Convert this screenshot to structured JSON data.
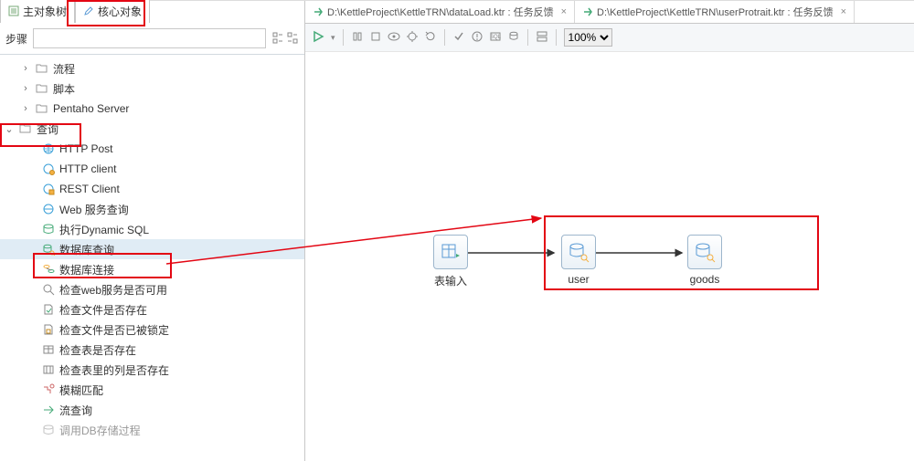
{
  "tabs": {
    "main_object_tree": "主对象树",
    "core_object": "核心对象"
  },
  "filter": {
    "label": "步骤",
    "placeholder": ""
  },
  "tree": {
    "folders": [
      {
        "label": "流程"
      },
      {
        "label": "脚本"
      },
      {
        "label": "Pentaho Server"
      },
      {
        "label": "查询",
        "expanded": true
      }
    ],
    "query_children": [
      "HTTP Post",
      "HTTP client",
      "REST Client",
      "Web 服务查询",
      "执行Dynamic SQL",
      "数据库查询",
      "数据库连接",
      "检查web服务是否可用",
      "检查文件是否存在",
      "检查文件是否已被锁定",
      "检查表是否存在",
      "检查表里的列是否存在",
      "模糊匹配",
      "流查询",
      "调用DB存储过程"
    ]
  },
  "editor": {
    "tabs": [
      {
        "path": "D:\\KettleProject\\KettleTRN\\dataLoad.ktr : 任务反馈"
      },
      {
        "path": "D:\\KettleProject\\KettleTRN\\userProtrait.ktr : 任务反馈"
      }
    ],
    "zoom": "100%"
  },
  "canvas": {
    "nodes": [
      {
        "id": "table_input",
        "label": "表输入"
      },
      {
        "id": "user",
        "label": "user"
      },
      {
        "id": "goods",
        "label": "goods"
      }
    ]
  }
}
